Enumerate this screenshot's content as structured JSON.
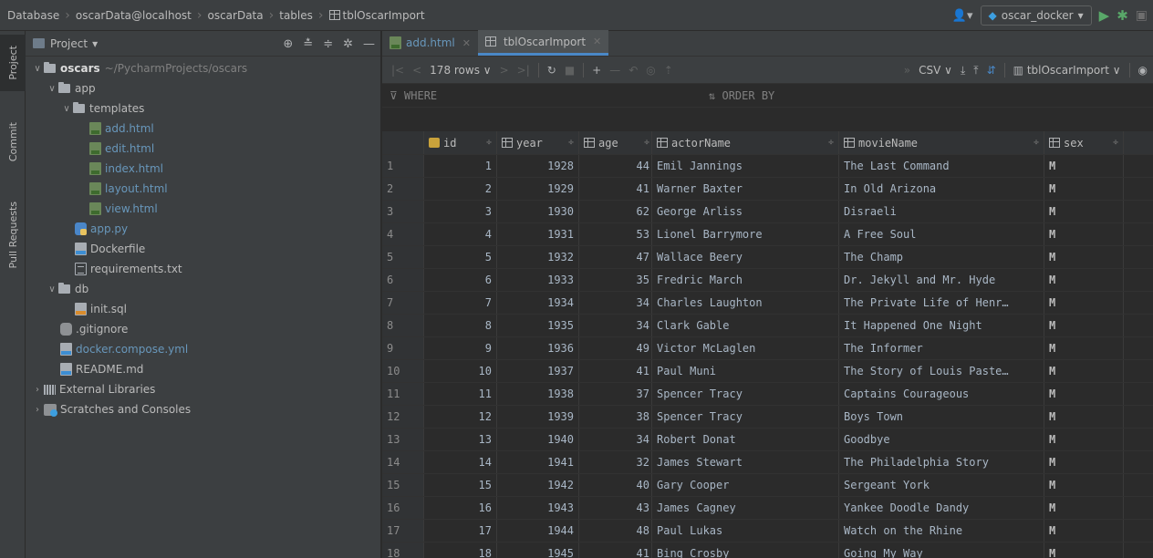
{
  "breadcrumb": [
    "Database",
    "oscarData@localhost",
    "oscarData",
    "tables",
    "tblOscarImport"
  ],
  "run_config": {
    "label": "oscar_docker"
  },
  "tool_strip": {
    "project": "Project",
    "commit": "Commit",
    "pull_requests": "Pull Requests"
  },
  "project_panel": {
    "title": "Project",
    "root": {
      "name": "oscars",
      "path": "~/PycharmProjects/oscars"
    },
    "items": [
      {
        "label": "app"
      },
      {
        "label": "templates"
      },
      {
        "label": "add.html"
      },
      {
        "label": "edit.html"
      },
      {
        "label": "index.html"
      },
      {
        "label": "layout.html"
      },
      {
        "label": "view.html"
      },
      {
        "label": "app.py"
      },
      {
        "label": "Dockerfile"
      },
      {
        "label": "requirements.txt"
      },
      {
        "label": "db"
      },
      {
        "label": "init.sql"
      },
      {
        "label": ".gitignore"
      },
      {
        "label": "docker.compose.yml"
      },
      {
        "label": "README.md"
      },
      {
        "label": "External Libraries"
      },
      {
        "label": "Scratches and Consoles"
      }
    ]
  },
  "tabs": [
    {
      "label": "add.html"
    },
    {
      "label": "tblOscarImport"
    }
  ],
  "toolbar": {
    "rows": "178 rows",
    "export_format": "CSV",
    "table_selector": "tblOscarImport"
  },
  "filter": {
    "where": "WHERE",
    "order_by": "ORDER BY"
  },
  "grid": {
    "columns": [
      "id",
      "year",
      "age",
      "actorName",
      "movieName",
      "sex"
    ],
    "rows": [
      [
        "1",
        "1",
        "1928",
        "44",
        "Emil Jannings",
        "The Last Command",
        "M"
      ],
      [
        "2",
        "2",
        "1929",
        "41",
        "Warner Baxter",
        "In Old Arizona",
        "M"
      ],
      [
        "3",
        "3",
        "1930",
        "62",
        "George Arliss",
        "Disraeli",
        "M"
      ],
      [
        "4",
        "4",
        "1931",
        "53",
        "Lionel Barrymore",
        "A Free Soul",
        "M"
      ],
      [
        "5",
        "5",
        "1932",
        "47",
        "Wallace Beery",
        "The Champ",
        "M"
      ],
      [
        "6",
        "6",
        "1933",
        "35",
        "Fredric March",
        "Dr. Jekyll and Mr. Hyde",
        "M"
      ],
      [
        "7",
        "7",
        "1934",
        "34",
        "Charles Laughton",
        "The Private Life of Henr…",
        "M"
      ],
      [
        "8",
        "8",
        "1935",
        "34",
        "Clark Gable",
        "It Happened One Night",
        "M"
      ],
      [
        "9",
        "9",
        "1936",
        "49",
        "Victor McLaglen",
        "The Informer",
        "M"
      ],
      [
        "10",
        "10",
        "1937",
        "41",
        "Paul Muni",
        "The Story of Louis Paste…",
        "M"
      ],
      [
        "11",
        "11",
        "1938",
        "37",
        "Spencer Tracy",
        "Captains Courageous",
        "M"
      ],
      [
        "12",
        "12",
        "1939",
        "38",
        "Spencer Tracy",
        "Boys Town",
        "M"
      ],
      [
        "13",
        "13",
        "1940",
        "34",
        "Robert Donat",
        "Goodbye",
        "M"
      ],
      [
        "14",
        "14",
        "1941",
        "32",
        "James Stewart",
        "The Philadelphia Story",
        "M"
      ],
      [
        "15",
        "15",
        "1942",
        "40",
        "Gary Cooper",
        "Sergeant York",
        "M"
      ],
      [
        "16",
        "16",
        "1943",
        "43",
        "James Cagney",
        "Yankee Doodle Dandy",
        "M"
      ],
      [
        "17",
        "17",
        "1944",
        "48",
        "Paul Lukas",
        "Watch on the Rhine",
        "M"
      ],
      [
        "18",
        "18",
        "1945",
        "41",
        "Bing Crosby",
        "Going My Way",
        "M"
      ]
    ]
  }
}
